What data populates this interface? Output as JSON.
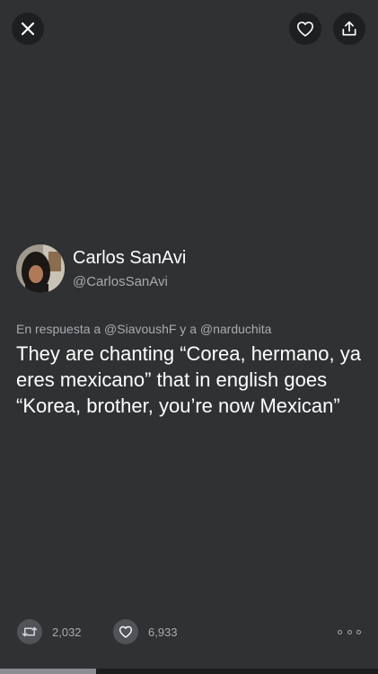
{
  "toolbar": {
    "close_icon": "close-icon",
    "like_icon": "heart-icon",
    "share_icon": "share-icon"
  },
  "tweet": {
    "author": {
      "name": "Carlos SanAvi",
      "handle": "@CarlosSanAvi"
    },
    "reply_to": "En respuesta a @SiavoushF y a @narduchita",
    "text": "They are chanting “Corea, hermano, ya eres mexicano” that in english goes “Korea, brother, you’re now Mexican”",
    "retweets": "2,032",
    "likes": "6,933"
  },
  "colors": {
    "background": "#2f3133",
    "secondary_text": "#a7acb1",
    "button_bg": "#1d1f21"
  },
  "progress": {
    "fraction": 0.254
  }
}
